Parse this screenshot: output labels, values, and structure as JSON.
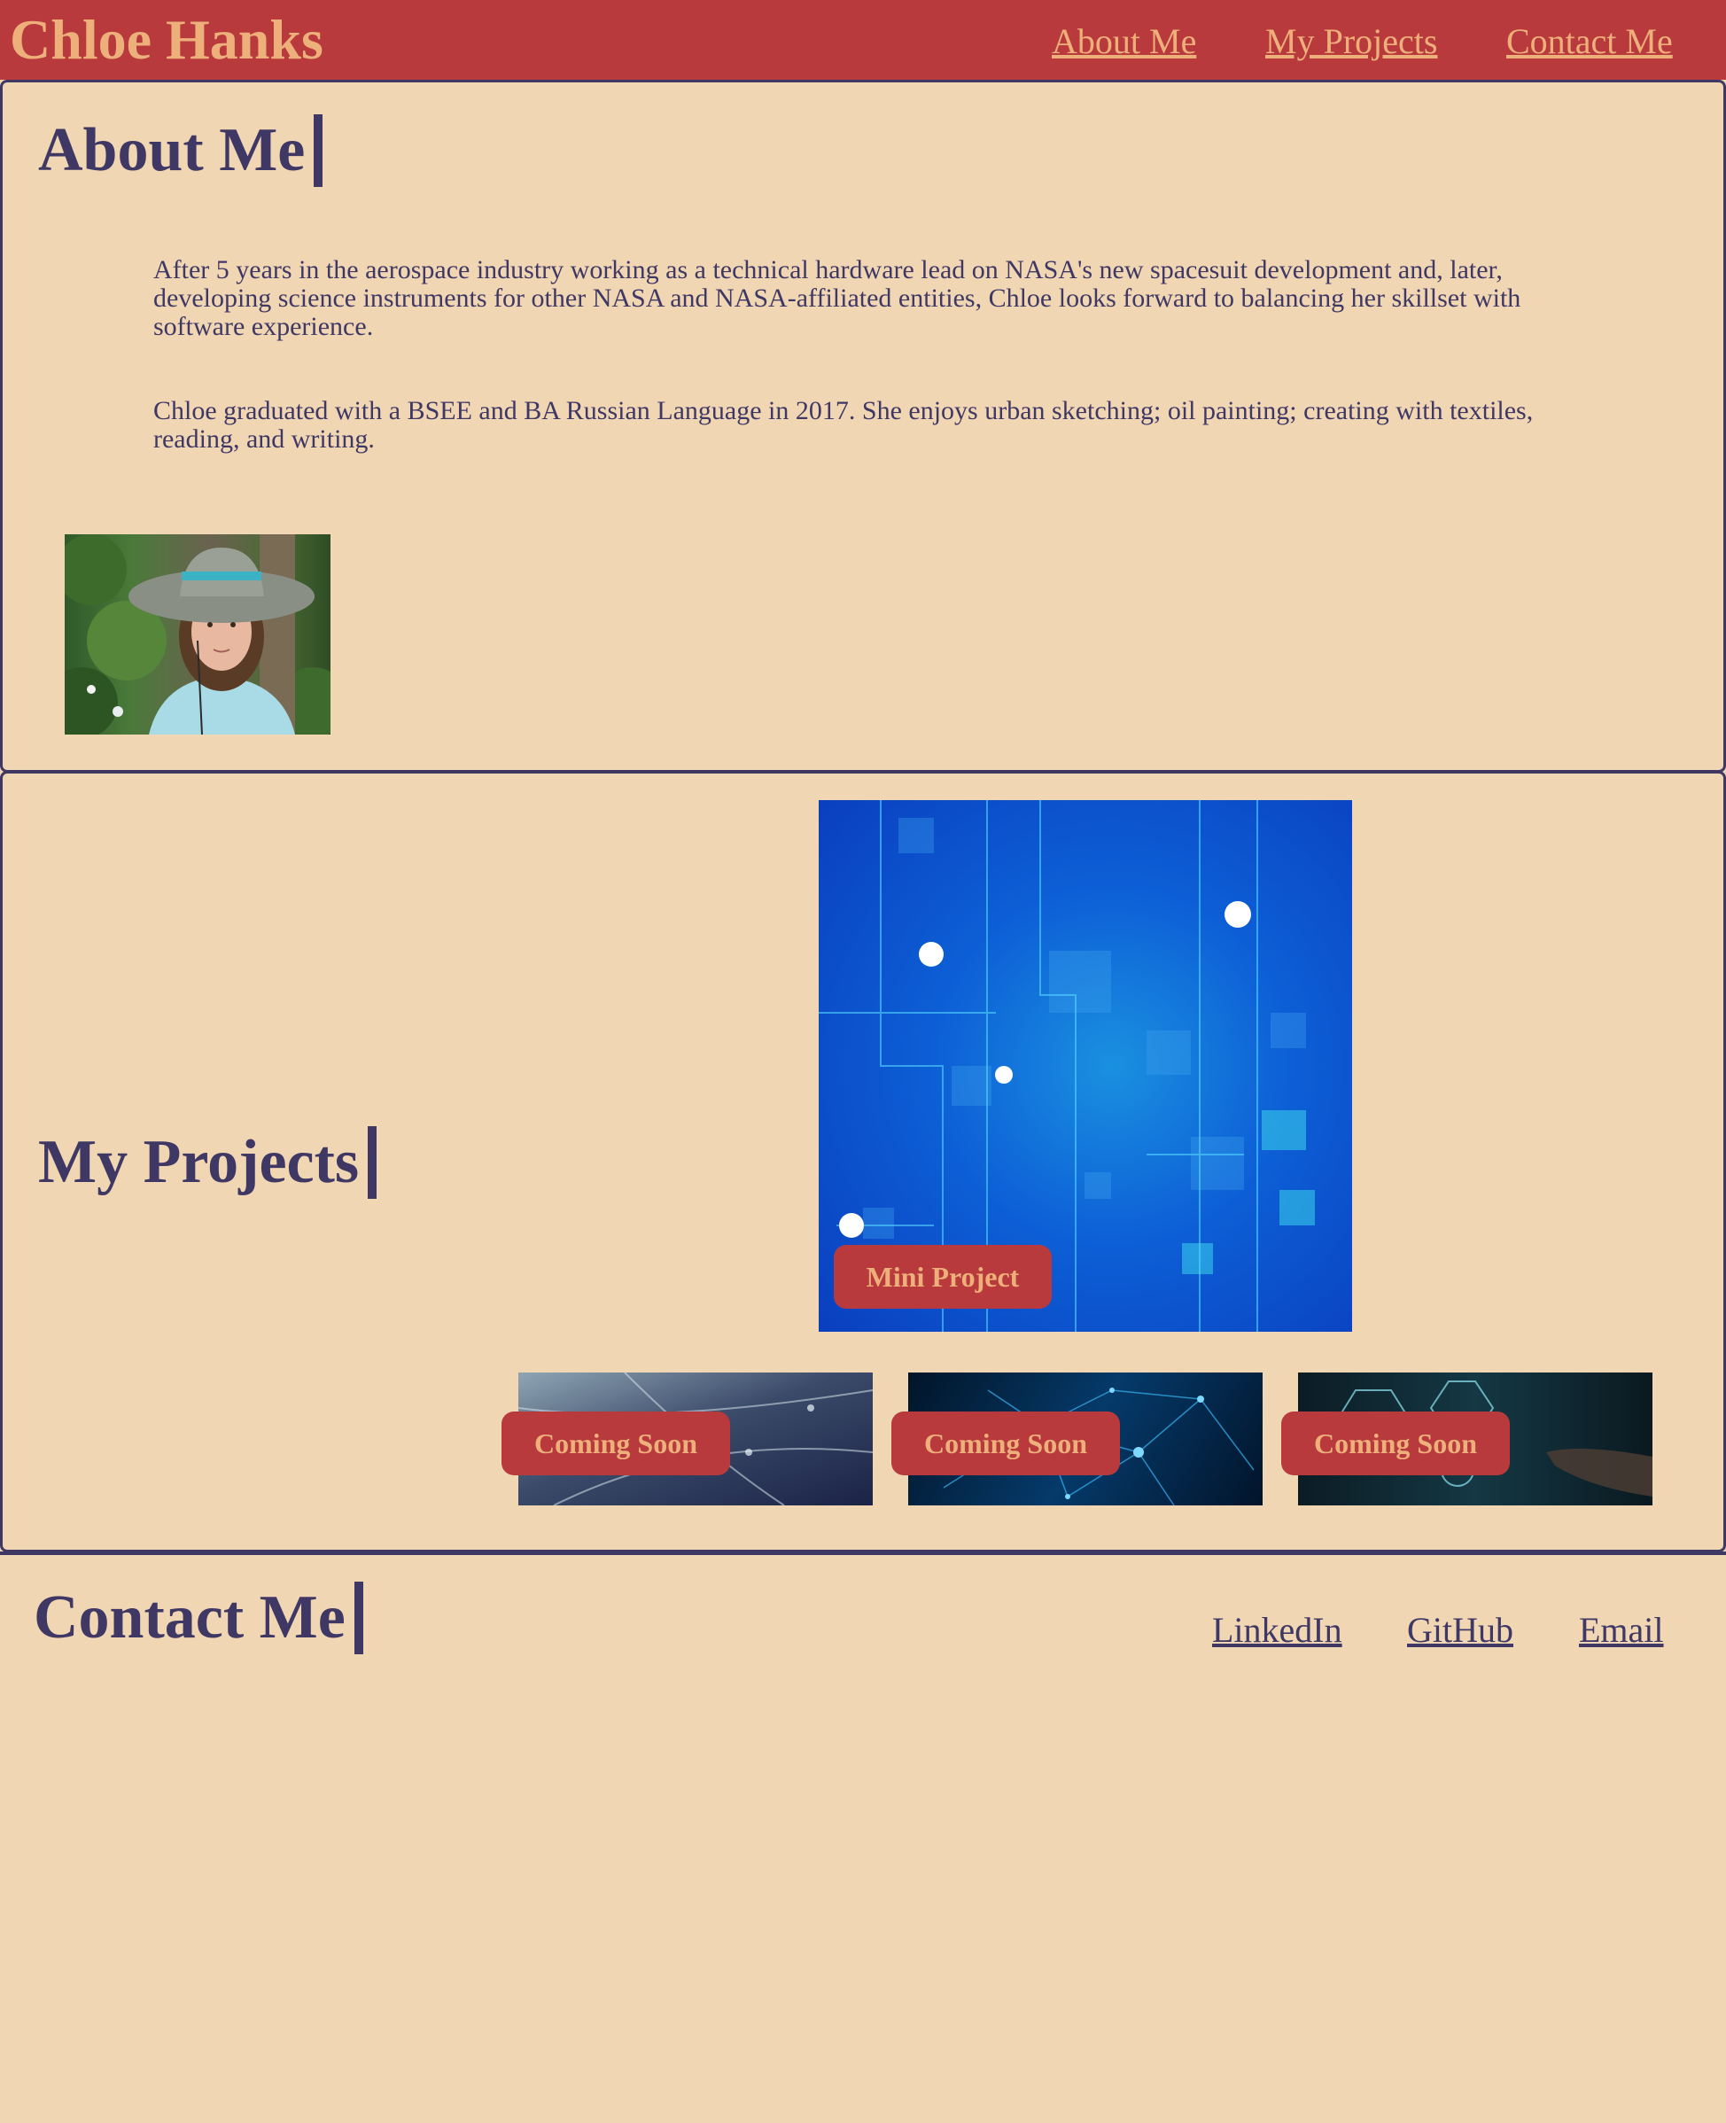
{
  "header": {
    "brand": "Chloe Hanks",
    "nav": {
      "about": "About Me",
      "projects": "My Projects",
      "contact": "Contact Me"
    },
    "background_color": "#b93a3d",
    "text_color": "#edb07a"
  },
  "about": {
    "heading": "About Me",
    "paragraphs": [
      "After 5 years in the aerospace industry working as a technical hardware lead on NASA's new spacesuit development and, later, developing science instruments for other NASA and NASA-affiliated entities, Chloe looks forward to balancing her skillset with software experience.",
      "Chloe graduated with a BSEE and BA Russian Language in 2017. She enjoys urban sketching; oil painting; creating with textiles, reading, and writing."
    ]
  },
  "projects": {
    "heading": "My Projects",
    "featured": {
      "label": "Mini Project"
    },
    "upcoming": [
      {
        "label": "Coming Soon"
      },
      {
        "label": "Coming Soon"
      },
      {
        "label": "Coming Soon"
      }
    ]
  },
  "contact": {
    "heading": "Contact Me",
    "links": {
      "linkedin": "LinkedIn",
      "github": "GitHub",
      "email": "Email"
    }
  },
  "colors": {
    "page_background": "#f0d6b3",
    "accent_dark": "#403864",
    "accent_red": "#b93a3d"
  }
}
